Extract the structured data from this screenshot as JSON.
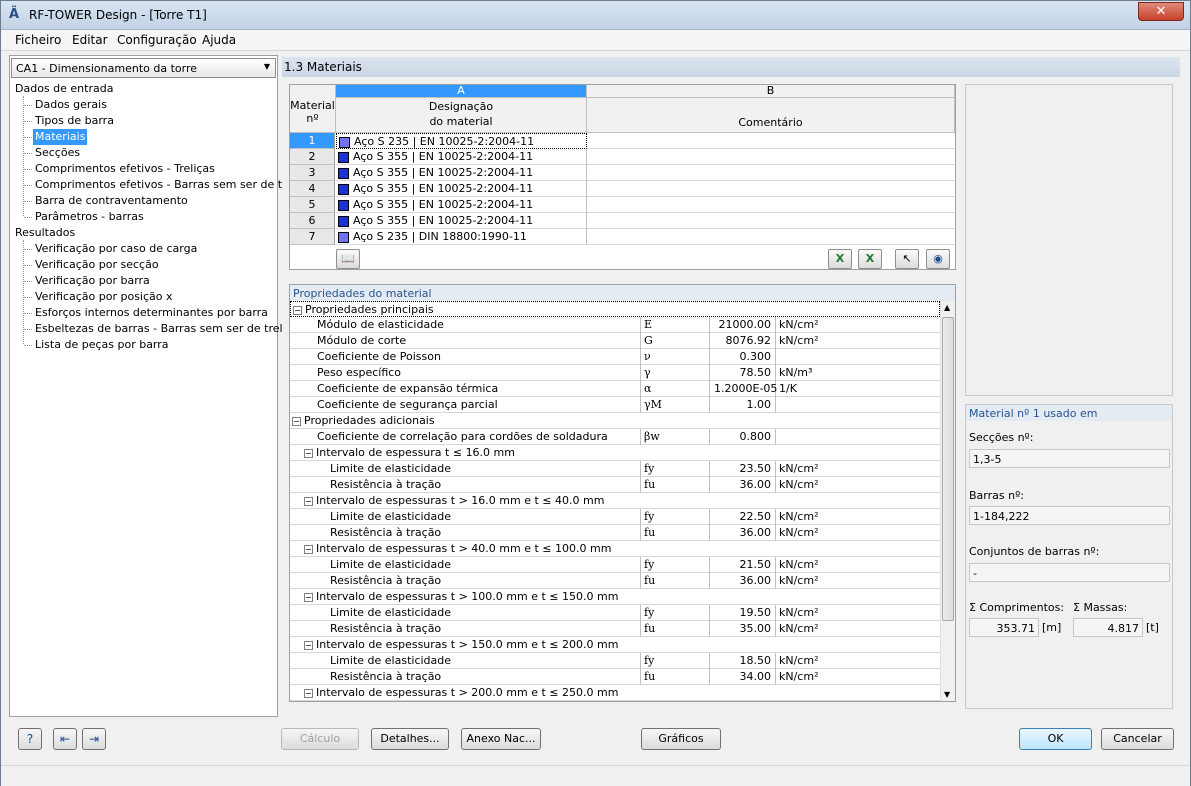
{
  "window": {
    "title": "RF-TOWER Design - [Torre T1]",
    "close_glyph": "✕"
  },
  "menu": [
    "Ficheiro",
    "Editar",
    "Configuração",
    "Ajuda"
  ],
  "case_select": "CA1 - Dimensionamento da torre",
  "tree": {
    "input_root": "Dados de entrada",
    "input_items": [
      "Dados gerais",
      "Tipos de barra",
      "Materiais",
      "Secções",
      "Comprimentos efetivos - Treliças",
      "Comprimentos efetivos - Barras sem ser de treliça",
      "Barra de contraventamento",
      "Parâmetros - barras"
    ],
    "results_root": "Resultados",
    "results_items": [
      "Verificação por caso de carga",
      "Verificação por secção",
      "Verificação por barra",
      "Verificação por posição x",
      "Esforços internos determinantes por barra",
      "Esbeltezas de barras - Barras sem ser de treliça",
      "Lista de peças por barra"
    ]
  },
  "section_title": "1.3 Materiais",
  "table": {
    "col_a": "A",
    "col_b": "B",
    "hdr_num_1": "Material",
    "hdr_num_2": "nº",
    "hdr_a_1": "Designação",
    "hdr_a_2": "do material",
    "hdr_b": "Comentário",
    "rows": [
      {
        "n": "1",
        "name": "Aço S 235 | EN 10025-2:2004-11"
      },
      {
        "n": "2",
        "name": "Aço S 355 | EN 10025-2:2004-11"
      },
      {
        "n": "3",
        "name": "Aço S 355 | EN 10025-2:2004-11"
      },
      {
        "n": "4",
        "name": "Aço S 355 | EN 10025-2:2004-11"
      },
      {
        "n": "5",
        "name": "Aço S 355 | EN 10025-2:2004-11"
      },
      {
        "n": "6",
        "name": "Aço S 355 | EN 10025-2:2004-11"
      },
      {
        "n": "7",
        "name": "Aço S 235 | DIN 18800:1990-11"
      }
    ]
  },
  "props": {
    "title": "Propriedades do material",
    "main": "Propriedades principais",
    "rows_main": [
      {
        "name": "Módulo de elasticidade",
        "sym": "E",
        "val": "21000.00",
        "unit": "kN/cm²"
      },
      {
        "name": "Módulo de corte",
        "sym": "G",
        "val": "8076.92",
        "unit": "kN/cm²"
      },
      {
        "name": "Coeficiente de Poisson",
        "sym": "ν",
        "val": "0.300",
        "unit": ""
      },
      {
        "name": "Peso específico",
        "sym": "γ",
        "val": "78.50",
        "unit": "kN/m³"
      },
      {
        "name": "Coeficiente de expansão térmica",
        "sym": "α",
        "val": "1.2000E-05",
        "unit": "1/K"
      },
      {
        "name": "Coeficiente de segurança parcial",
        "sym": "γM",
        "val": "1.00",
        "unit": ""
      }
    ],
    "additional": "Propriedades adicionais",
    "weld": {
      "name": "Coeficiente de correlação para cordões de soldadura",
      "sym": "βw",
      "val": "0.800"
    },
    "groups": [
      {
        "title": "Intervalo de espessura t ≤ 16.0 mm",
        "fy": "23.50",
        "fu": "36.00"
      },
      {
        "title": "Intervalo de espessuras t > 16.0 mm e t ≤ 40.0 mm",
        "fy": "22.50",
        "fu": "36.00"
      },
      {
        "title": "Intervalo de espessuras t > 40.0 mm e t ≤ 100.0 mm",
        "fy": "21.50",
        "fu": "36.00"
      },
      {
        "title": "Intervalo de espessuras t > 100.0 mm e t ≤ 150.0 mm",
        "fy": "19.50",
        "fu": "35.00"
      },
      {
        "title": "Intervalo de espessuras t > 150.0 mm e t ≤ 200.0 mm",
        "fy": "18.50",
        "fu": "34.00"
      }
    ],
    "last_group": "Intervalo de espessuras t > 200.0 mm e t ≤ 250.0 mm",
    "fy_name": "Limite de elasticidade",
    "fy_sym": "fy",
    "fu_name": "Resistência à tração",
    "fu_sym": "fu",
    "stress_unit": "kN/cm²"
  },
  "info": {
    "title": "Material nº 1 usado em",
    "sections_label": "Secções nº:",
    "sections_val": "1,3-5",
    "members_label": "Barras nº:",
    "members_val": "1-184,222",
    "sets_label": "Conjuntos de barras nº:",
    "sets_val": "-",
    "len_label": "Σ Comprimentos:",
    "len_val": "353.71",
    "len_unit": "[m]",
    "mass_label": "Σ Massas:",
    "mass_val": "4.817",
    "mass_unit": "[t]"
  },
  "buttons": {
    "calc": "Cálculo",
    "details": "Detalhes...",
    "annex": "Anexo Nac...",
    "graphics": "Gráficos",
    "ok": "OK",
    "cancel": "Cancelar"
  }
}
